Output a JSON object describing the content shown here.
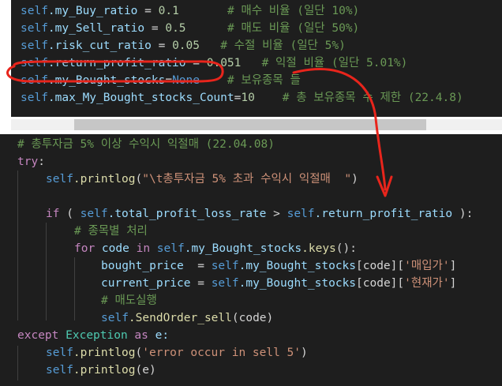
{
  "top_code": {
    "l1": {
      "self": "self",
      "attr": ".my_Buy_ratio",
      "op": " = ",
      "num": "0.1",
      "pad": "       ",
      "cmt": "# 매수 비율 (일단 10%)"
    },
    "l2": {
      "self": "self",
      "attr": ".my_Sell_ratio",
      "op": " = ",
      "num": "0.5",
      "pad": "      ",
      "cmt": "# 매도 비율 (일단 50%)"
    },
    "l3": {
      "self": "self",
      "attr": ".risk_cut_ratio",
      "op": " = ",
      "num": "0.05",
      "pad": "   ",
      "cmt": "# 수절 비율 (일단 5%)"
    },
    "l4": {
      "self": "self",
      "attr": ".return_profit_ratio",
      "op": " = ",
      "num": "0.051",
      "pad": "   ",
      "cmt": "# 익절 비율 (일단 5.01%)"
    },
    "l5": {
      "self": "self",
      "attr": ".my_Bought_stocks",
      "op": "=",
      "kw": "None",
      "pad": "    ",
      "cmt": "# 보유종목 들"
    },
    "l6": {
      "self": "self",
      "attr": ".max_My_Bought_stocks_Count",
      "op": "=",
      "num": "10",
      "pad": "    ",
      "cmt": "# 총 보유종목 수 제한 (22.4.8)"
    }
  },
  "bottom_code": {
    "b1": {
      "cmt": "# 총투자금 5% 이상 수익시 익절매 (22.04.08)"
    },
    "b2": {
      "kw": "try",
      "op": ":"
    },
    "b3": {
      "self": "self",
      "fn": ".printlog",
      "p1": "(",
      "str": "\"\\t총투자금 5% 초과 수익시 익절매  \"",
      "p2": ")"
    },
    "b4": {
      "kw": "if",
      "p1": " ( ",
      "self1": "self",
      "attr1": ".total_profit_loss_rate",
      "op": " > ",
      "self2": "self",
      "attr2": ".return_profit_ratio",
      "p2": " ):"
    },
    "b5": {
      "cmt": "# 종목별 처리"
    },
    "b6": {
      "kw1": "for",
      "v": " code ",
      "kw2": "in",
      "sp": " ",
      "self": "self",
      "attr": ".my_Bought_stocks",
      "fn": ".keys",
      "p": "():"
    },
    "b7": {
      "v": "bought_price",
      "op": "  = ",
      "self": "self",
      "attr": ".my_Bought_stocks",
      "p1": "[code][",
      "str": "'매입가'",
      "p2": "]"
    },
    "b8": {
      "v": "current_price",
      "op": " = ",
      "self": "self",
      "attr": ".my_Bought_stocks",
      "p1": "[code][",
      "str": "'현재가'",
      "p2": "]"
    },
    "b9": {
      "cmt": "# 매도실행"
    },
    "b10": {
      "self": "self",
      "fn": ".SendOrder_sell",
      "p": "(code)"
    },
    "b11": {
      "kw1": "except",
      "sp": " ",
      "cls": "Exception",
      "kw2": " as ",
      "v": "e:"
    },
    "b12": {
      "self": "self",
      "fn": ".printlog",
      "p1": "(",
      "str": "'error occur in sell 5'",
      "p2": ")"
    },
    "b13": {
      "self": "self",
      "fn": ".printlog",
      "p": "(e)"
    }
  },
  "colors": {
    "background": "#1e1e1e",
    "annotation": "#e8251c"
  }
}
